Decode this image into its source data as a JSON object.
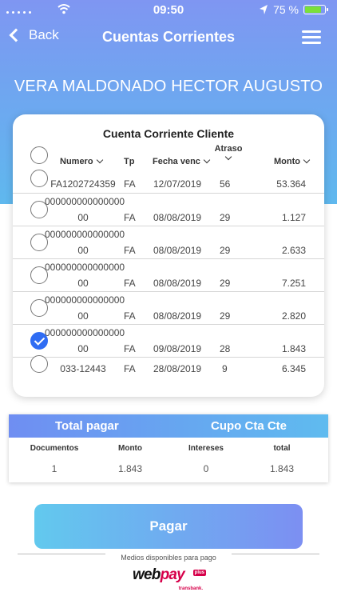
{
  "status": {
    "time": "09:50",
    "battery_pct": "75 %",
    "battery_level": 0.75
  },
  "nav": {
    "back_label": "Back",
    "title": "Cuentas Corrientes"
  },
  "customer_name": "VERA MALDONADO HECTOR AUGUSTO",
  "card": {
    "title": "Cuenta Corriente Cliente",
    "columns": {
      "numero": "Numero",
      "tp": "Tp",
      "fecha": "Fecha venc",
      "atraso": "Atraso",
      "monto": "Monto"
    }
  },
  "rows": [
    {
      "numero": "FA1202724359",
      "numero2": "",
      "tp": "FA",
      "fecha": "12/07/2019",
      "atraso": "56",
      "monto": "53.364",
      "checked": false
    },
    {
      "numero": "000000000000000",
      "numero2": "00",
      "tp": "FA",
      "fecha": "08/08/2019",
      "atraso": "29",
      "monto": "1.127",
      "checked": false
    },
    {
      "numero": "000000000000000",
      "numero2": "00",
      "tp": "FA",
      "fecha": "08/08/2019",
      "atraso": "29",
      "monto": "2.633",
      "checked": false
    },
    {
      "numero": "000000000000000",
      "numero2": "00",
      "tp": "FA",
      "fecha": "08/08/2019",
      "atraso": "29",
      "monto": "7.251",
      "checked": false
    },
    {
      "numero": "000000000000000",
      "numero2": "00",
      "tp": "FA",
      "fecha": "08/08/2019",
      "atraso": "29",
      "monto": "2.820",
      "checked": false
    },
    {
      "numero": "000000000000000",
      "numero2": "00",
      "tp": "FA",
      "fecha": "09/08/2019",
      "atraso": "28",
      "monto": "1.843",
      "checked": true
    },
    {
      "numero": "033-12443",
      "numero2": "",
      "tp": "FA",
      "fecha": "28/08/2019",
      "atraso": "9",
      "monto": "6.345",
      "checked": false
    }
  ],
  "summary": {
    "total_pagar": "Total pagar",
    "cupo": "Cupo Cta Cte",
    "labels": {
      "documentos": "Documentos",
      "monto": "Monto",
      "intereses": "Intereses",
      "total": "total"
    },
    "values": {
      "documentos": "1",
      "monto": "1.843",
      "intereses": "0",
      "total": "1.843"
    }
  },
  "pay_button": "Pagar",
  "pay_note": "Medios disponibles para pago",
  "webpay": {
    "brand_a": "web",
    "brand_b": "pay",
    "plus": "plus",
    "transbank": "transbank."
  },
  "colors": {
    "accent": "#2f6cf3",
    "gradient_start": "#7f96f2",
    "gradient_end": "#5fb8ee",
    "webpay_red": "#d6004a"
  }
}
